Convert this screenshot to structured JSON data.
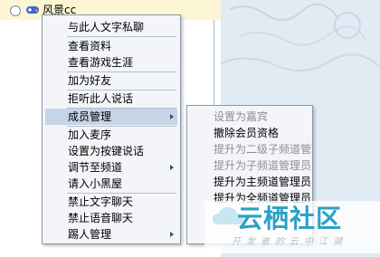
{
  "list_row": {
    "user_name": "风景cc"
  },
  "context_menu": {
    "items": [
      {
        "label": "与此人文字私聊"
      },
      {
        "label": "查看资料"
      },
      {
        "label": "查看游戏生涯"
      },
      {
        "label": "加为好友"
      },
      {
        "label": "拒听此人说话"
      },
      {
        "label": "成员管理",
        "highlighted": true,
        "has_submenu": true
      },
      {
        "label": "加入麦序"
      },
      {
        "label": "设置为按键说话"
      },
      {
        "label": "调节至频道",
        "has_submenu": true
      },
      {
        "label": "请入小黑屋"
      },
      {
        "label": "禁止文字聊天"
      },
      {
        "label": "禁止语音聊天"
      },
      {
        "label": "踢人管理",
        "has_submenu": true
      }
    ]
  },
  "submenu": {
    "items": [
      {
        "label": "设置为嘉宾",
        "enabled": false
      },
      {
        "label": "撤除会员资格",
        "enabled": true
      },
      {
        "label": "提升为二级子频道管理员",
        "enabled": false
      },
      {
        "label": "提升为子频道管理员",
        "enabled": false
      },
      {
        "label": "提升为主频道管理员",
        "enabled": true
      },
      {
        "label": "提升为全频道管理员",
        "enabled": true
      }
    ]
  },
  "watermark": {
    "title": "云栖社区",
    "subtitle": "开发者的云中江湖"
  },
  "colors": {
    "highlight": "#c5d4e6",
    "menu_bg": "#f3f5f9",
    "disabled_text": "#8f8f8f",
    "watermark_blue": "#2aa1c8",
    "row_bg": "#fdf6d4"
  }
}
